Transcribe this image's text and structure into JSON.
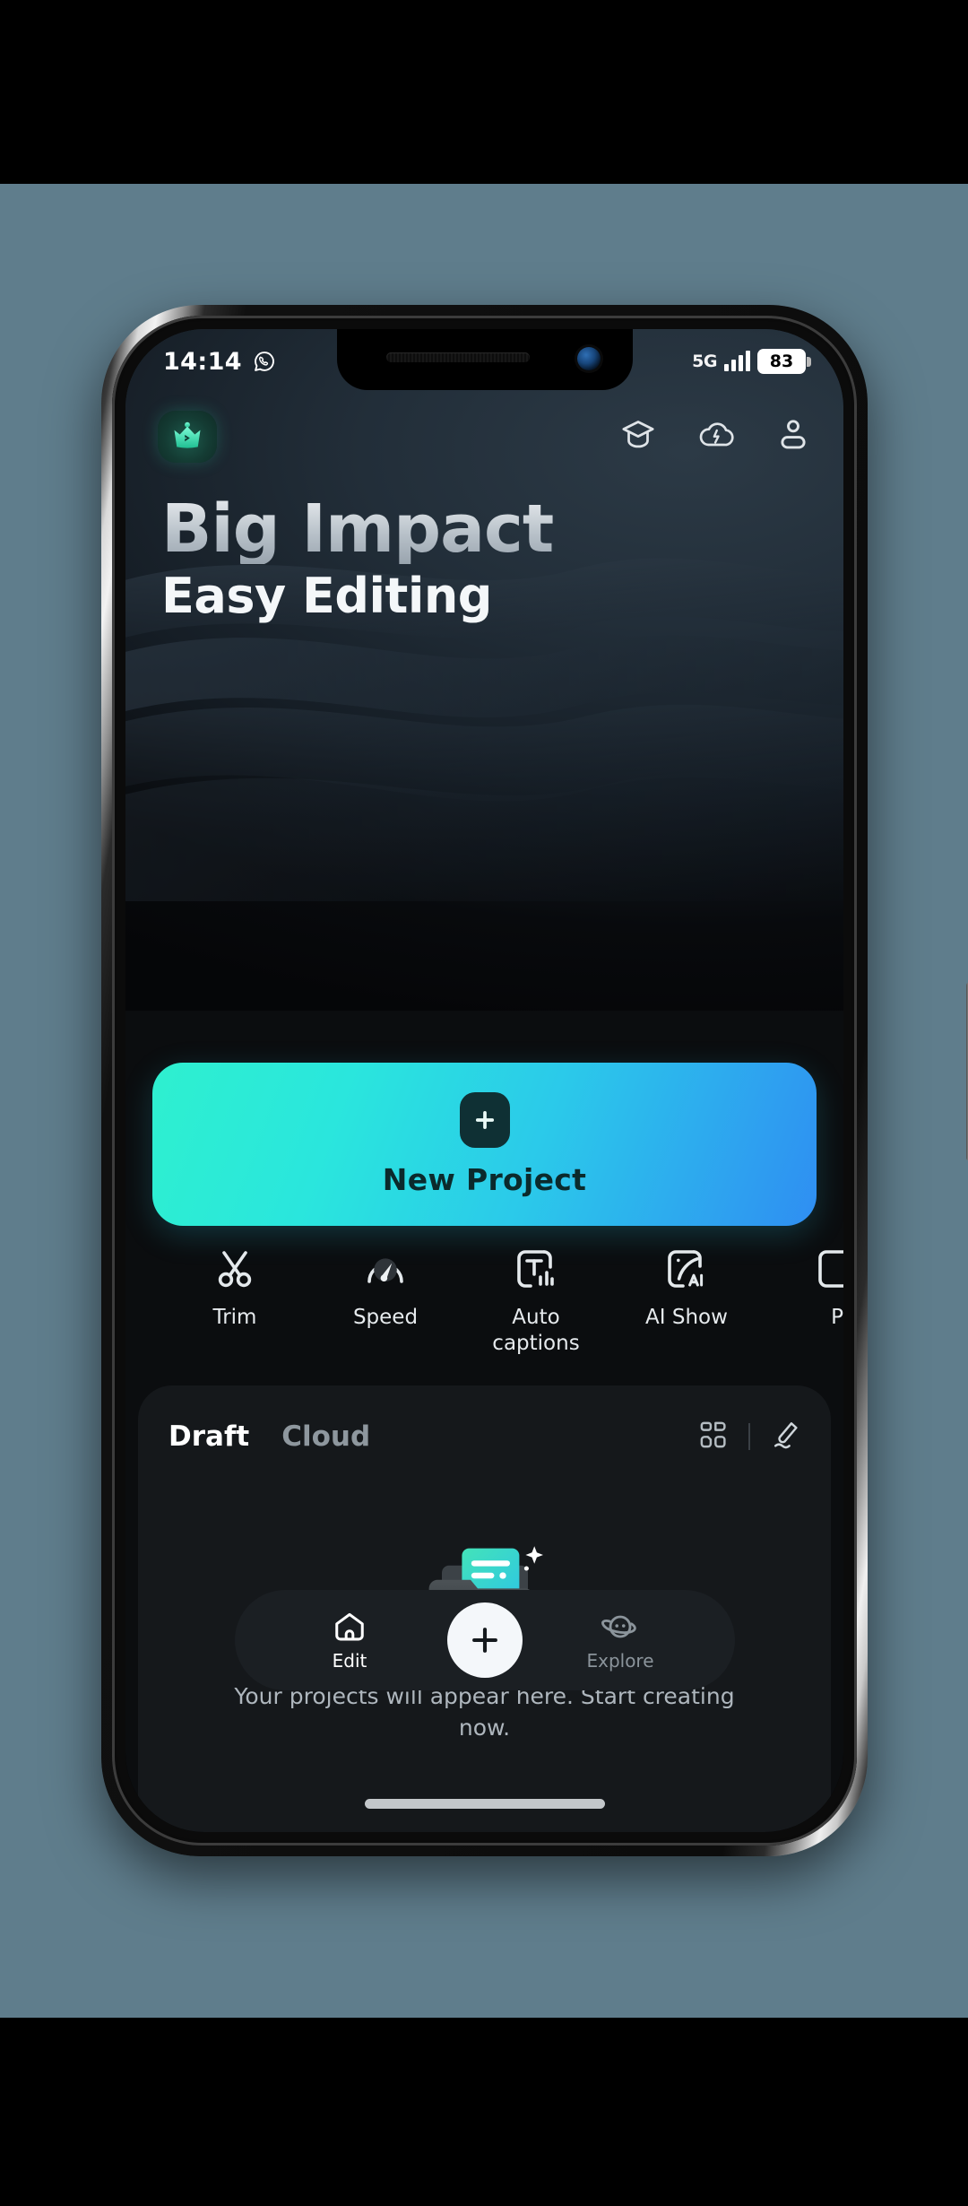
{
  "status_bar": {
    "time": "14:14",
    "app_icon": "whatsapp-icon",
    "network": "5G",
    "battery_level": "83"
  },
  "top_nav": {
    "premium_badge": "crown-icon",
    "icons": [
      {
        "name": "graduation-cap-icon",
        "label": "Tutorials"
      },
      {
        "name": "cloud-icon",
        "label": "Cloud"
      },
      {
        "name": "profile-icon",
        "label": "Profile"
      }
    ]
  },
  "hero": {
    "line1": "Big Impact",
    "line2": "Easy Editing"
  },
  "new_project": {
    "label": "New Project",
    "icon": "plus-icon",
    "gradient_start": "#2ef0cf",
    "gradient_end": "#2f8ef2"
  },
  "tools": [
    {
      "label": "Trim",
      "icon": "scissors-icon"
    },
    {
      "label": "Speed",
      "icon": "speedometer-icon"
    },
    {
      "label": "Auto\ncaptions",
      "icon": "captions-icon"
    },
    {
      "label": "AI Show",
      "icon": "ai-show-icon"
    },
    {
      "label": "P",
      "icon": "partial-icon"
    }
  ],
  "panel": {
    "tabs": [
      {
        "label": "Draft",
        "active": true
      },
      {
        "label": "Cloud",
        "active": false
      }
    ],
    "actions": [
      {
        "name": "grid-view-icon"
      },
      {
        "name": "edit-pencil-icon"
      }
    ],
    "empty_state": {
      "illustration": "folder-with-document-icon",
      "message": "Your projects will appear here. Start creating now."
    }
  },
  "bottom_nav": {
    "items": [
      {
        "label": "Edit",
        "icon": "home-icon",
        "active": true
      },
      {
        "label": "Explore",
        "icon": "planet-icon",
        "active": false
      }
    ],
    "fab": {
      "icon": "plus-icon"
    }
  },
  "colors": {
    "backdrop": "#5f7d8c",
    "accent_teal": "#2ef0cf",
    "accent_blue": "#2f8ef2",
    "panel_bg": "#15181b"
  }
}
